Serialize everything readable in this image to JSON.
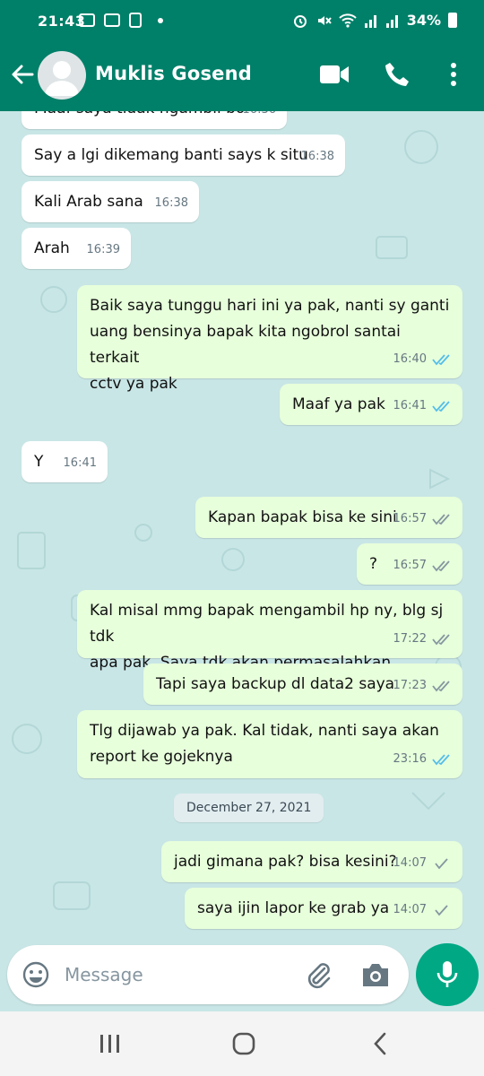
{
  "status_bar": {
    "time": "21:43",
    "battery": "34%"
  },
  "header": {
    "contact_name": "Muklis Gosend"
  },
  "messages": [
    {
      "text": "Maaf saya tidak ngambil bo",
      "time": "16:36"
    },
    {
      "text": "Say a lgi dikemang banti says k situ",
      "time": "16:38"
    },
    {
      "text": "Kali Arab sana",
      "time": "16:38"
    },
    {
      "text": "Arah",
      "time": "16:39"
    },
    {
      "line1": "Baik saya tunggu hari ini ya pak, nanti sy ganti",
      "line2": "uang bensinya bapak kita ngobrol santai terkait",
      "line3": "cctv ya pak",
      "time": "16:40"
    },
    {
      "text": "Maaf ya pak",
      "time": "16:41"
    },
    {
      "text": "Y",
      "time": "16:41"
    },
    {
      "text": "Kapan bapak bisa ke sini",
      "time": "16:57"
    },
    {
      "text": "?",
      "time": "16:57"
    },
    {
      "line1": "Kal misal mmg bapak mengambil hp ny, blg sj tdk",
      "line2": "apa pak. Saya tdk akan permasalahkan",
      "time": "17:22"
    },
    {
      "text": "Tapi saya backup dl data2 saya",
      "time": "17:23"
    },
    {
      "line1": "Tlg dijawab ya pak. Kal tidak, nanti saya akan",
      "line2": "report ke gojeknya",
      "time": "23:16"
    },
    {
      "text": "jadi gimana pak? bisa kesini?",
      "time": "14:07"
    },
    {
      "text": "saya ijin lapor ke grab ya",
      "time": "14:07"
    }
  ],
  "date_divider": "December 27, 2021",
  "composer": {
    "placeholder": "Message"
  },
  "colors": {
    "header": "#008069",
    "chat_bg": "#c9e6e6",
    "outgoing": "#e7ffdb",
    "incoming": "#ffffff",
    "read_tick": "#53bdeb",
    "sent_tick": "#8696a0",
    "fab": "#00a884"
  },
  "icons": [
    "back-arrow-icon",
    "avatar-icon",
    "video-call-icon",
    "phone-icon",
    "more-vert-icon",
    "emoji-icon",
    "attach-icon",
    "camera-icon",
    "mic-icon",
    "recents-icon",
    "home-icon",
    "back-nav-icon"
  ]
}
